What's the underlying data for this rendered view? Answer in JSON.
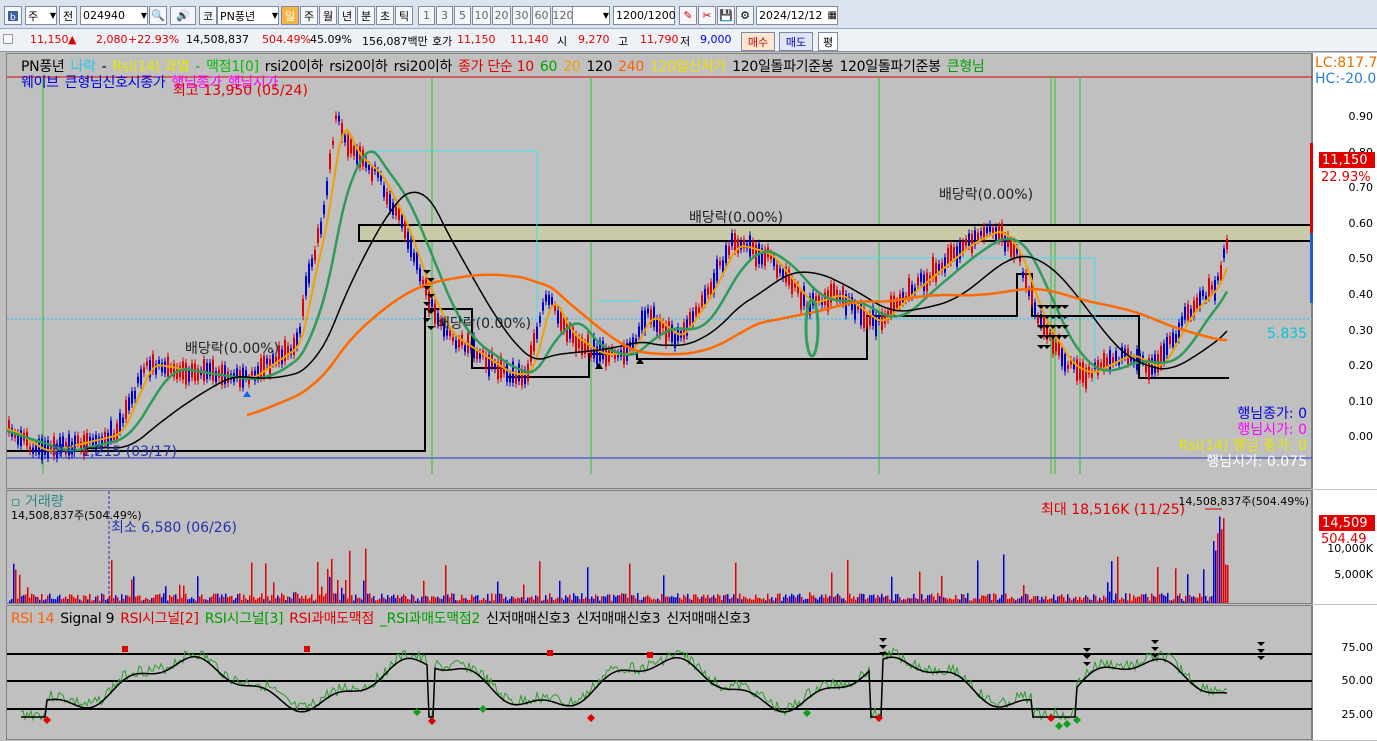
{
  "toolbar": {
    "period_type": "주",
    "prev_label": "전",
    "code": "024940",
    "market": "코",
    "stock_name": "PN풍년",
    "periods": [
      "일",
      "주",
      "월",
      "년",
      "분",
      "초",
      "틱"
    ],
    "active_period": "일",
    "intervals": [
      "1",
      "3",
      "5",
      "10",
      "20",
      "30",
      "60",
      "120"
    ],
    "count": "1200",
    "count_total": "/1200",
    "date": "2024/12/12"
  },
  "quote": {
    "price": "11,150",
    "up_arrow": "▲",
    "change": "2,080",
    "change_pct": "+22.93%",
    "volume": "14,508,837",
    "volume_pct": "504.49%",
    "turnover_pct": "45.09%",
    "amount": "156,087백만",
    "hoga_label": "호가",
    "ask": "11,150",
    "bid": "11,140",
    "open_label": "시",
    "open": "9,270",
    "high_label": "고",
    "high": "11,790",
    "low_label": "저",
    "low": "9,000",
    "buy_label": "매수",
    "sell_label": "매도",
    "eval_label": "평"
  },
  "price_panel": {
    "legend_line1": [
      {
        "text": "PN풍년",
        "color": "#000"
      },
      {
        "text": "나락",
        "color": "#21c9f0"
      },
      {
        "text": "-",
        "color": "#000"
      },
      {
        "text": "Rsi(14) 과열",
        "color": "#e6e600"
      },
      {
        "text": "-",
        "color": "#00b000"
      },
      {
        "text": "맥점1[0]",
        "color": "#00c000"
      },
      {
        "text": "rsi20이하",
        "color": "#000"
      },
      {
        "text": "rsi20이하",
        "color": "#000"
      },
      {
        "text": "rsi20이하",
        "color": "#000"
      },
      {
        "text": "종가 단순 10",
        "color": "#e00000"
      },
      {
        "text": "60",
        "color": "#00a000"
      },
      {
        "text": "20",
        "color": "#f0a000"
      },
      {
        "text": "120",
        "color": "#000"
      },
      {
        "text": "240",
        "color": "#ff6000"
      },
      {
        "text": "120일신저가",
        "color": "#f0e000"
      },
      {
        "text": "120일돌파기준봉",
        "color": "#000"
      },
      {
        "text": "120일돌파기준봉",
        "color": "#000"
      },
      {
        "text": "큰형님",
        "color": "#00a000"
      }
    ],
    "legend_line2": [
      {
        "text": "웨이브",
        "color": "#0000e0"
      },
      {
        "text": "큰형님신호시종가",
        "color": "#0000e0"
      },
      {
        "text": "행님종가",
        "color": "#ff00ff"
      },
      {
        "text": "행님시가",
        "color": "#ff00ff"
      }
    ],
    "max_label": "최고 13,950 (05/24)",
    "min_label": "최저 1,215 (03/17)",
    "div_labels": [
      "배당락(0.00%)",
      "배당락(0.00%)",
      "배당락(0.00%)",
      "배당락(0.00%)"
    ],
    "right_top": [
      "LC:817.7",
      "HC:-20.0"
    ],
    "current_price_tag": "11,150",
    "current_pct_tag": "22.93%",
    "level_label": "5.835",
    "info_labels": [
      "행님종가: 0",
      "행님시가: 0",
      "Rsi(14) 행님 종가: 0",
      "행님시가: 0.075"
    ],
    "y_ticks": [
      "0.90",
      "0.80",
      "0.70",
      "0.60",
      "0.50",
      "0.40",
      "0.30",
      "0.20",
      "0.10",
      "0.00"
    ]
  },
  "volume_panel": {
    "title": "거래량",
    "sub": "14,508,837주(504.49%)",
    "min_label": "최소 6,580 (06/26)",
    "max_label": "최대 18,516K (11/25)",
    "top_right": "14,508,837주(504.49%)",
    "vol_tag": "14,509",
    "vol_pct_tag": "504.49",
    "y_ticks": [
      "10,000K",
      "5,000K"
    ]
  },
  "rsi_panel": {
    "legend": [
      {
        "text": "RSI 14",
        "color": "#ff6000"
      },
      {
        "text": "Signal 9",
        "color": "#000"
      },
      {
        "text": "RSI시그널[2]",
        "color": "#e00000"
      },
      {
        "text": "RSI시그널[3]",
        "color": "#00a000"
      },
      {
        "text": "RSI과매도맥점",
        "color": "#e00000"
      },
      {
        "text": "_RSI과매도맥점2",
        "color": "#00a000"
      },
      {
        "text": "신저매매신호3",
        "color": "#000"
      },
      {
        "text": "신저매매신호3",
        "color": "#000"
      },
      {
        "text": "신저매매신호3",
        "color": "#000"
      }
    ],
    "y_ticks": [
      "75.00",
      "50.00",
      "25.00"
    ]
  },
  "colors": {
    "up": "#e00000",
    "down": "#0000e0",
    "ma10": "#e00000",
    "ma20": "#f0a000",
    "ma60": "#2e9b5a",
    "ma120": "#000000",
    "ma240": "#ff6a00"
  }
}
